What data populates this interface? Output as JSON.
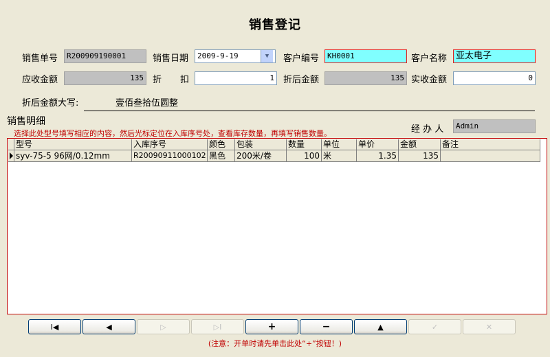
{
  "title": "销售登记",
  "fields": {
    "sale_no_label": "销售单号",
    "sale_no": "R200909190001",
    "sale_date_label": "销售日期",
    "sale_date": "2009-9-19",
    "customer_no_label": "客户编号",
    "customer_no": "KH0001",
    "customer_name_label": "客户名称",
    "customer_name": "亚太电子",
    "receivable_label": "应收金额",
    "receivable": "135",
    "discount_label_1": "折",
    "discount_label_2": "扣",
    "discount": "1",
    "after_discount_label": "折后金额",
    "after_discount": "135",
    "received_label": "实收金额",
    "received": "0",
    "capital_label": "折后金额大写:",
    "capital": "壹佰叁拾伍圆整"
  },
  "details": {
    "section_label": "销售明细",
    "hint": "选择此处型号填写相应的内容，然后光标定位在入库序号处，查看库存数量，再填写销售数量。",
    "handler_label": "经 办 人",
    "handler": "Admin"
  },
  "grid": {
    "columns": [
      "型号",
      "入库序号",
      "颜色",
      "包装",
      "数量",
      "单位",
      "单价",
      "金额",
      "备注"
    ],
    "rows": [
      [
        "syv-75-5 96网/0.12mm",
        "R20090911000102",
        "黑色",
        "200米/卷",
        "100",
        "米",
        "1.35",
        "135",
        ""
      ]
    ]
  },
  "nav": {
    "first": "I◀",
    "prev": "◀",
    "next": "▷",
    "last": "▷I",
    "add": "+",
    "delete": "−",
    "up": "▲",
    "save": "✓",
    "cancel": "✕"
  },
  "note": "(注意：开单时请先单击此处“+”按钮！)"
}
